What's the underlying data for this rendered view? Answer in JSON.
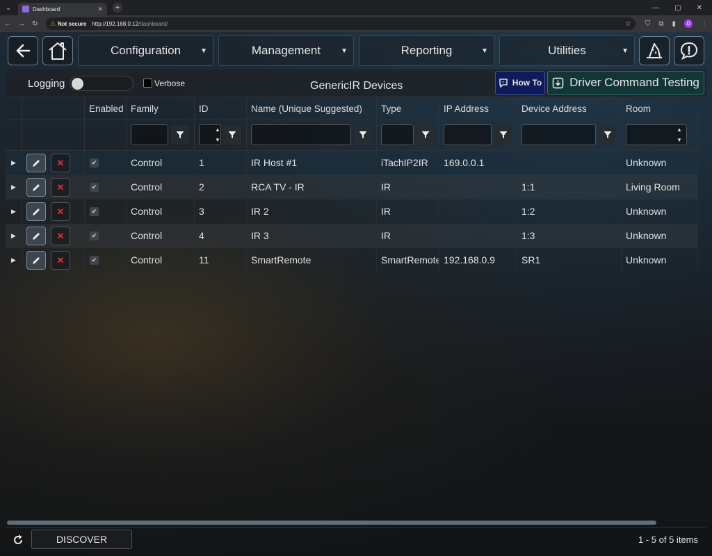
{
  "browser": {
    "tab_title": "Dashboard",
    "not_secure": "Not secure",
    "url_host": "http://192.168.0.12",
    "url_path": "/dashboard/",
    "profile_initial": "D"
  },
  "nav": {
    "menus": [
      {
        "label": "Configuration"
      },
      {
        "label": "Management"
      },
      {
        "label": "Reporting"
      },
      {
        "label": "Utilities"
      }
    ]
  },
  "toolbar": {
    "logging_label": "Logging",
    "logging_on": false,
    "verbose_label": "Verbose",
    "verbose_checked": false,
    "title": "GenericIR Devices",
    "howto_label": "How To",
    "driver_testing_label": "Driver Command Testing"
  },
  "grid": {
    "columns": [
      "Enabled",
      "Family",
      "ID",
      "Name (Unique Suggested)",
      "Type",
      "IP Address",
      "Device Address",
      "Room"
    ],
    "rows": [
      {
        "enabled": true,
        "family": "Control",
        "id": "1",
        "name": "IR Host #1",
        "type": "iTachIP2IR",
        "ip": "169.0.0.1",
        "device_address": "",
        "room": "Unknown"
      },
      {
        "enabled": true,
        "family": "Control",
        "id": "2",
        "name": "RCA TV - IR",
        "type": "IR",
        "ip": "",
        "device_address": "1:1",
        "room": "Living Room"
      },
      {
        "enabled": true,
        "family": "Control",
        "id": "3",
        "name": "IR 2",
        "type": "IR",
        "ip": "",
        "device_address": "1:2",
        "room": "Unknown"
      },
      {
        "enabled": true,
        "family": "Control",
        "id": "4",
        "name": "IR 3",
        "type": "IR",
        "ip": "",
        "device_address": "1:3",
        "room": "Unknown"
      },
      {
        "enabled": true,
        "family": "Control",
        "id": "11",
        "name": "SmartRemote",
        "type": "SmartRemote",
        "ip": "192.168.0.9",
        "device_address": "SR1",
        "room": "Unknown"
      }
    ]
  },
  "footer": {
    "discover_label": "DISCOVER",
    "pager_text": "1 - 5 of 5 items"
  },
  "colors": {
    "accent_howto": "#0f1a5a",
    "accent_testing": "#123636",
    "delete_red": "#e03030"
  }
}
